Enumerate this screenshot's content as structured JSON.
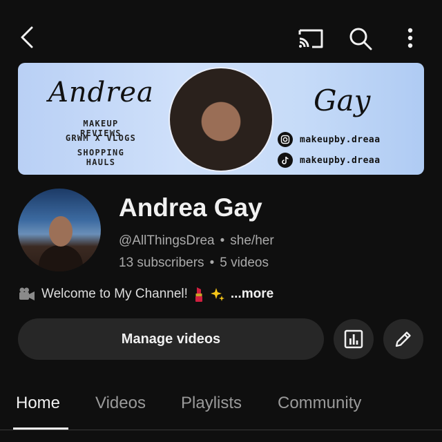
{
  "header": {
    "icons": [
      "back-icon",
      "cast-icon",
      "search-icon",
      "more-vert-icon"
    ]
  },
  "banner": {
    "first_name": "Andrea",
    "last_name": "Gay",
    "taglines": [
      "MAKEUP REVIEWS",
      "GRWM X VLOGS",
      "SHOPPING HAULS"
    ],
    "instagram": "makeupby.dreaa",
    "tiktok": "makeupby.dreaa"
  },
  "channel": {
    "name": "Andrea Gay",
    "handle": "@AllThingsDrea",
    "pronouns": "she/her",
    "subscribers": "13 subscribers",
    "videos": "5 videos",
    "description": "Welcome to My Channel!",
    "more_label": "...more"
  },
  "actions": {
    "manage_label": "Manage videos",
    "icons": [
      "analytics-icon",
      "edit-icon"
    ]
  },
  "tabs": [
    {
      "label": "Home",
      "active": true
    },
    {
      "label": "Videos",
      "active": false
    },
    {
      "label": "Playlists",
      "active": false
    },
    {
      "label": "Community",
      "active": false
    }
  ],
  "colors": {
    "background": "#0f0f0f",
    "button_bg": "#272727",
    "text_primary": "#f1f1f1",
    "text_secondary": "#aaaaaa"
  }
}
